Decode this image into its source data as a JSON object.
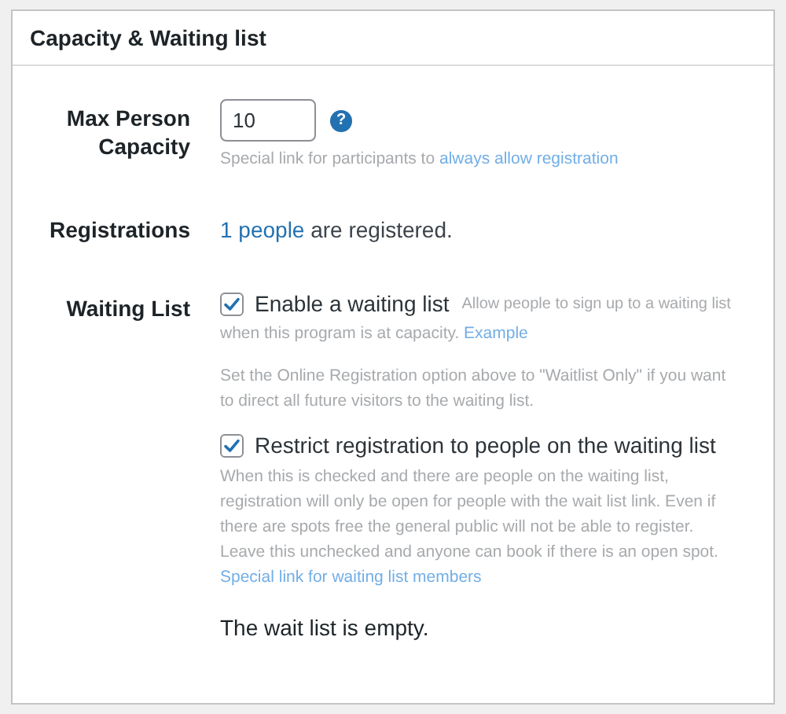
{
  "panel": {
    "title": "Capacity & Waiting list"
  },
  "capacity": {
    "label": "Max Person Capacity",
    "value": "10",
    "help_icon": "?",
    "help_text": "Special link for participants to ",
    "help_link": "always allow registration"
  },
  "registrations": {
    "label": "Registrations",
    "link": "1 people",
    "text": " are registered."
  },
  "waiting_list": {
    "label": "Waiting List",
    "options": [
      {
        "label": "Enable a waiting list",
        "checked": true,
        "description": "Allow people to sign up to a waiting list",
        "description_cont": "when this program is at capacity. ",
        "link": "Example",
        "note": "Set the Online Registration option above to \"Waitlist Only\" if you want to direct all future visitors to the waiting list."
      },
      {
        "label": "Restrict registration to people on the waiting list",
        "checked": true,
        "description": "When this is checked and there are people on the waiting list, registration will only be open for people with the wait list link. Even if there are spots free the general public will not be able to register. Leave this unchecked and anyone can book if there is an open spot.",
        "link": "Special link for waiting list members"
      }
    ],
    "status": "The wait list is empty."
  }
}
